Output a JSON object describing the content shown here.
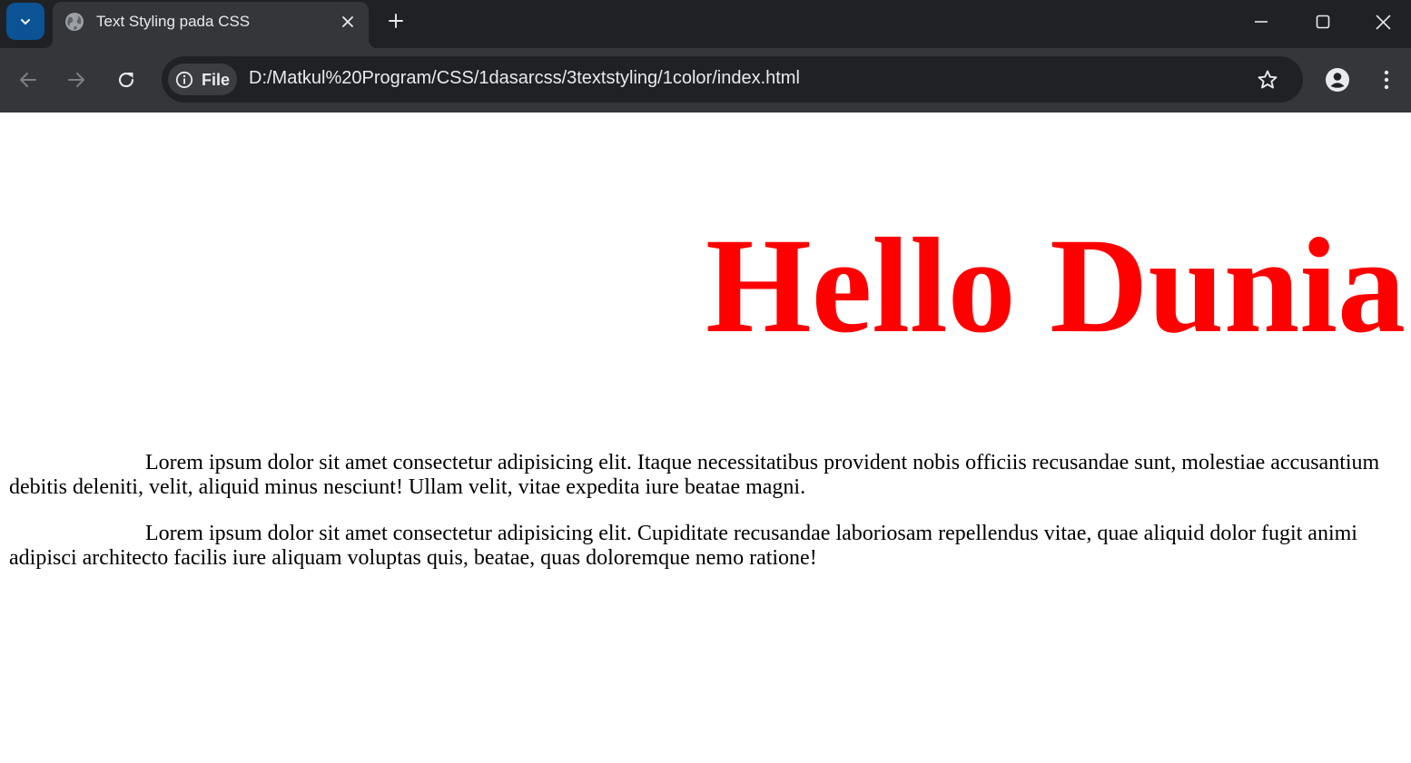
{
  "browser": {
    "tab": {
      "title": "Text Styling pada CSS",
      "favicon": "globe-icon"
    },
    "icons": {
      "tab_search": "chevron-down-icon",
      "close_tab": "close-icon",
      "new_tab": "plus-icon",
      "minimize": "minimize-icon",
      "maximize": "maximize-icon",
      "close_window": "close-icon",
      "back": "arrow-left-icon",
      "forward": "arrow-right-icon",
      "reload": "reload-icon",
      "site_info": "info-icon",
      "bookmark": "star-icon",
      "profile": "profile-icon",
      "menu": "kebab-menu-icon"
    },
    "address_bar": {
      "chip_label": "File",
      "url": "D:/Matkul%20Program/CSS/1dasarcss/3textstyling/1color/index.html"
    },
    "colors": {
      "tabstrip_bg": "#202124",
      "toolbar_bg": "#35363a",
      "tab_search_bg": "#0b5394"
    }
  },
  "page": {
    "heading": "Hello Dunia",
    "heading_color": "#ff0000",
    "paragraphs": [
      "Lorem ipsum dolor sit amet consectetur adipisicing elit. Itaque necessitatibus provident nobis officiis recusandae sunt, molestiae accusantium debitis deleniti, velit, aliquid minus nesciunt! Ullam velit, vitae expedita iure beatae magni.",
      "Lorem ipsum dolor sit amet consectetur adipisicing elit. Cupiditate recusandae laboriosam repellendus vitae, quae aliquid dolor fugit animi adipisci architecto facilis iure aliquam voluptas quis, beatae, quas doloremque nemo ratione!"
    ]
  }
}
